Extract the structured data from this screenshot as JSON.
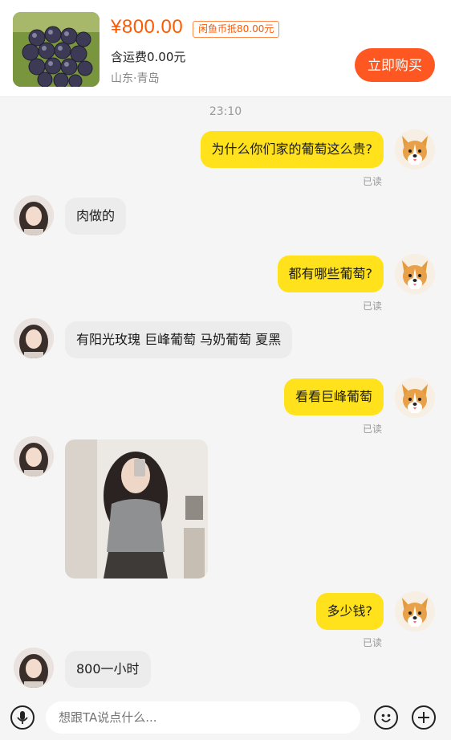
{
  "product": {
    "price": "¥800.00",
    "coin_tag": "闲鱼币抵80.00元",
    "shipping": "含运费0.00元",
    "location": "山东·青岛",
    "buy_label": "立即购买",
    "image_icon": "grapes-photo"
  },
  "chat": {
    "timestamp": "23:10",
    "read_label": "已读",
    "messages": [
      {
        "from": "me",
        "text": "为什么你们家的葡萄这么贵?",
        "read": true
      },
      {
        "from": "her",
        "text": "肉做的"
      },
      {
        "from": "me",
        "text": "都有哪些葡萄?",
        "read": true
      },
      {
        "from": "her",
        "text": "有阳光玫瑰 巨峰葡萄 马奶葡萄 夏黑"
      },
      {
        "from": "me",
        "text": "看看巨峰葡萄",
        "read": true
      },
      {
        "from": "her",
        "type": "image",
        "icon": "selfie-photo"
      },
      {
        "from": "me",
        "text": "多少钱?",
        "read": true
      },
      {
        "from": "her",
        "text": "800一小时"
      }
    ]
  },
  "input_bar": {
    "placeholder": "想跟TA说点什么...",
    "voice_icon": "microphone-icon",
    "emoji_icon": "emoji-icon",
    "plus_icon": "plus-icon"
  },
  "colors": {
    "accent": "#ff5722",
    "price": "#ff5a00",
    "my_bubble": "#ffe21c",
    "her_bubble": "#ececec"
  }
}
